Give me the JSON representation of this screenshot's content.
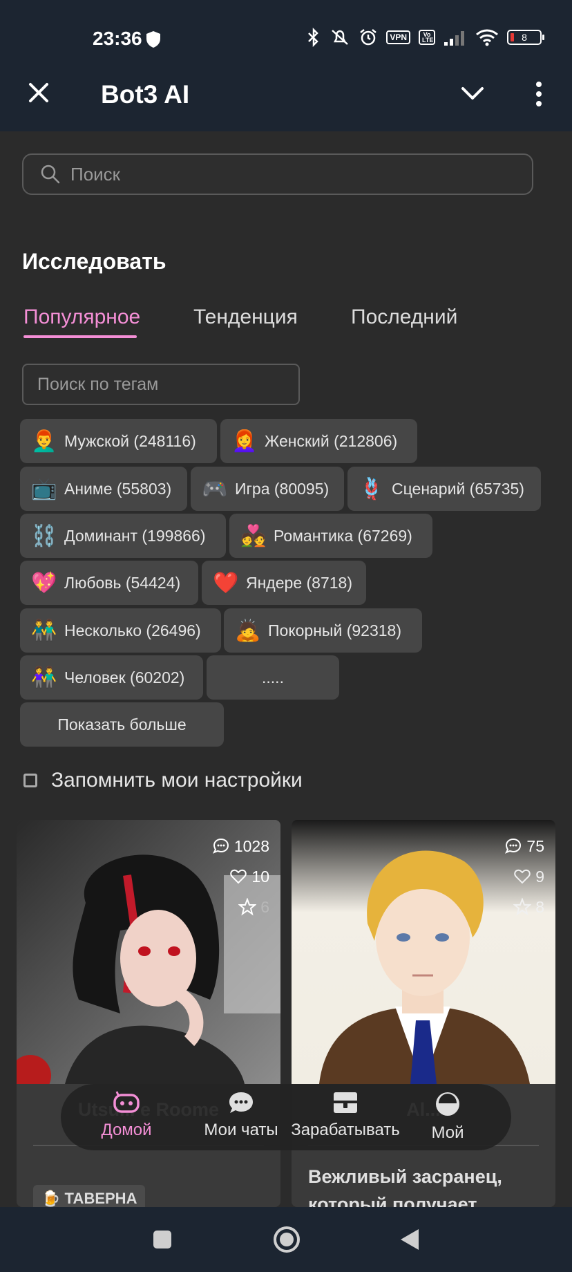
{
  "status_bar": {
    "time": "23:36",
    "vpn": "VPN",
    "volte": "Vo LTE",
    "battery": "8",
    "icons": [
      "shield-icon",
      "bluetooth-icon",
      "mute-icon",
      "alarm-icon",
      "signal-icon",
      "wifi-icon",
      "battery-icon"
    ]
  },
  "app_bar": {
    "title": "Bot3 AI",
    "icons": [
      "close-icon",
      "chevron-down-icon",
      "more-vert-icon"
    ]
  },
  "search": {
    "placeholder": "Поиск"
  },
  "explore": {
    "title": "Исследовать",
    "tabs": [
      {
        "label": "Популярное",
        "active": true
      },
      {
        "label": "Тенденция",
        "active": false
      },
      {
        "label": "Последний",
        "active": false
      }
    ],
    "tag_search_placeholder": "Поиск по тегам",
    "tags": [
      {
        "emoji": "👨‍🦰",
        "label": "Мужской (248116)"
      },
      {
        "emoji": "👩‍🦰",
        "label": "Женский (212806)"
      },
      {
        "emoji": "📺",
        "label": "Аниме (55803)"
      },
      {
        "emoji": "🎮",
        "label": "Игра (80095)"
      },
      {
        "emoji": "🪢",
        "label": "Сценарий (65735)"
      },
      {
        "emoji": "⛓️",
        "label": "Доминант (199866)"
      },
      {
        "emoji": "💑",
        "label": "Романтика (67269)"
      },
      {
        "emoji": "💖",
        "label": "Любовь (54424)"
      },
      {
        "emoji": "❤️",
        "label": "Яндере (8718)"
      },
      {
        "emoji": "👬",
        "label": "Несколько (26496)"
      },
      {
        "emoji": "🙇",
        "label": "Покорный (92318)"
      },
      {
        "emoji": "👫",
        "label": "Человек (60202)"
      },
      {
        "emoji": "",
        "label": "....."
      }
    ],
    "show_more": "Показать больше",
    "remember": "Запомнить мои настройки"
  },
  "cards": [
    {
      "chats": "1028",
      "likes": "10",
      "stars": "6",
      "name": "Utsu... e Roome",
      "tag": "🍺 ТАВЕРНА"
    },
    {
      "chats": "75",
      "likes": "9",
      "stars": "8",
      "name": "Al...",
      "desc": "Вежливый засранец, который получает"
    }
  ],
  "bottom_nav": [
    {
      "label": "Домой",
      "icon": "bot-icon",
      "active": true
    },
    {
      "label": "Мои чаты",
      "icon": "chat-bubble-icon",
      "active": false
    },
    {
      "label": "Зарабатывать",
      "icon": "wallet-icon",
      "active": false
    },
    {
      "label": "Мой",
      "icon": "profile-icon",
      "active": false
    }
  ],
  "colors": {
    "accent": "#f48fd6",
    "background": "#2b2b2b",
    "topbar": "#1c2531",
    "chip": "#464646"
  }
}
